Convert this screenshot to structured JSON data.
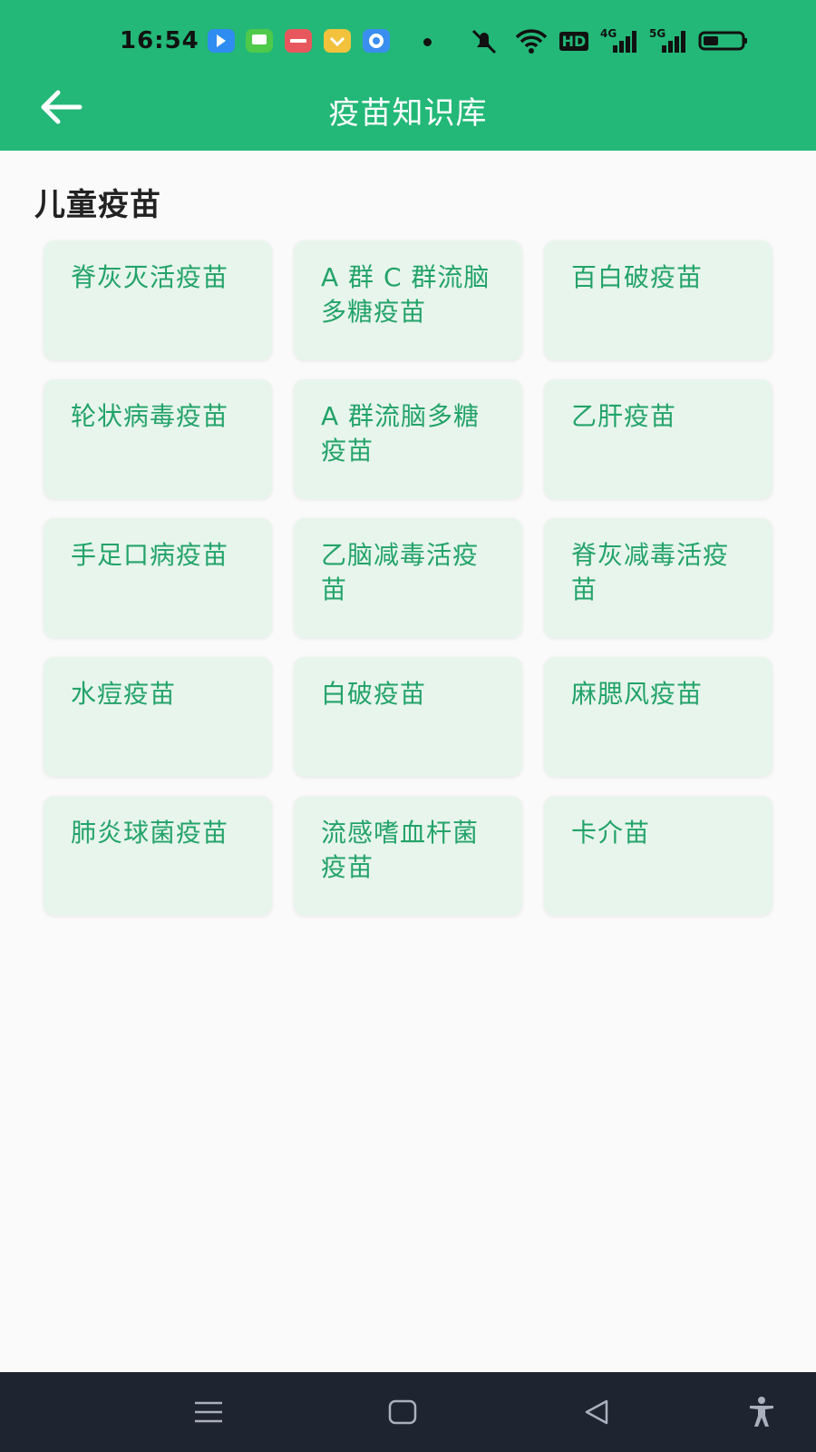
{
  "status_bar": {
    "time": "16:54",
    "network_badge": "HD",
    "signal_1": "4G",
    "signal_2": "5G"
  },
  "app_bar": {
    "title": "疫苗知识库"
  },
  "section": {
    "title": "儿童疫苗",
    "items": [
      {
        "label": "脊灰灭活疫苗"
      },
      {
        "label": "A 群 C 群流脑多糖疫苗"
      },
      {
        "label": "百白破疫苗"
      },
      {
        "label": "轮状病毒疫苗"
      },
      {
        "label": "A 群流脑多糖疫苗"
      },
      {
        "label": "乙肝疫苗"
      },
      {
        "label": "手足口病疫苗"
      },
      {
        "label": "乙脑减毒活疫苗"
      },
      {
        "label": "脊灰减毒活疫苗"
      },
      {
        "label": "水痘疫苗"
      },
      {
        "label": "白破疫苗"
      },
      {
        "label": "麻腮风疫苗"
      },
      {
        "label": "肺炎球菌疫苗"
      },
      {
        "label": "流感嗜血杆菌疫苗"
      },
      {
        "label": "卡介苗"
      }
    ]
  },
  "colors": {
    "primary": "#23b878",
    "card_bg": "#e8f5ec",
    "card_text": "#23a36a",
    "nav_bg": "#1f2431"
  }
}
